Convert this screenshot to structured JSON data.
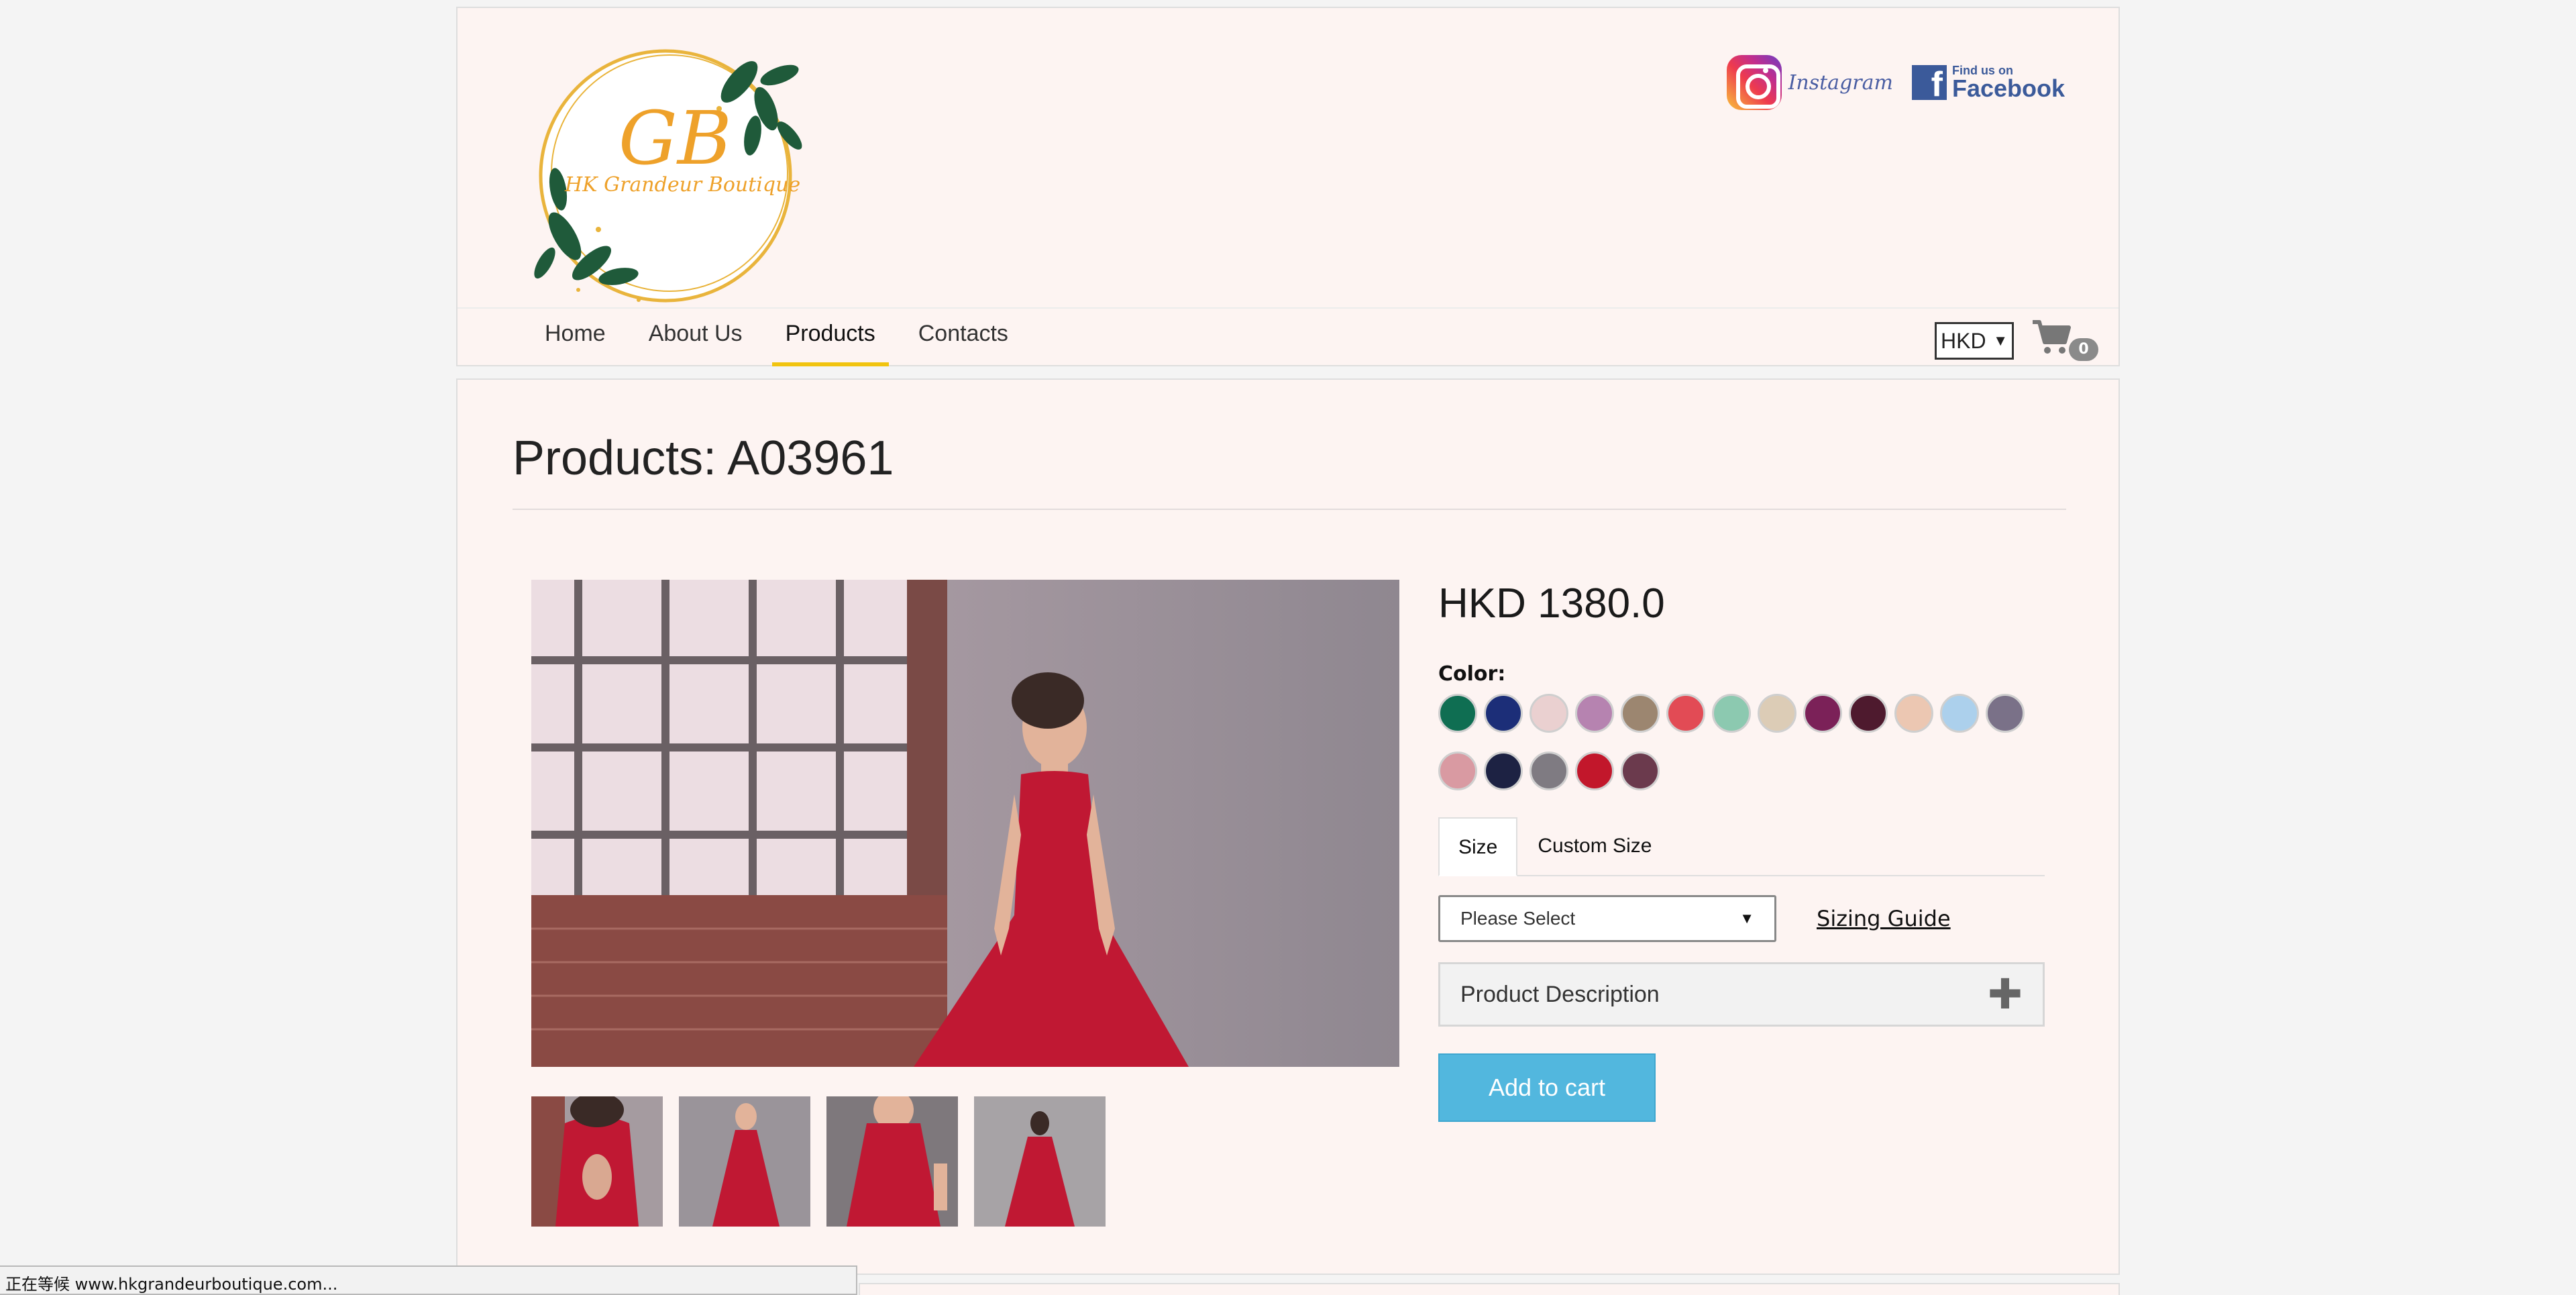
{
  "brand": {
    "logo_initials": "GB",
    "logo_name": "HK Grandeur Boutique"
  },
  "social": {
    "instagram_label": "Instagram",
    "facebook_small": "Find us on",
    "facebook_big": "Facebook"
  },
  "nav": {
    "items": [
      {
        "label": "Home"
      },
      {
        "label": "About Us"
      },
      {
        "label": "Products"
      },
      {
        "label": "Contacts"
      }
    ],
    "currency": "HKD",
    "cart_count": "0"
  },
  "product": {
    "title": "Products: A03961",
    "price": "HKD 1380.0",
    "color_label": "Color:",
    "colors": [
      "#0f6e52",
      "#1c2e78",
      "#ead0d0",
      "#b683b0",
      "#9c8670",
      "#e24b55",
      "#8cc9b0",
      "#dcccb6",
      "#7b2158",
      "#4e1a2e",
      "#ecc7b2",
      "#acd0ec",
      "#7a7188",
      "#d99aa2",
      "#1d2243",
      "#7f7b82",
      "#c2172b",
      "#6b3a4d"
    ],
    "tabs": [
      {
        "label": "Size"
      },
      {
        "label": "Custom Size"
      }
    ],
    "size_placeholder": "Please Select",
    "sizing_guide": "Sizing Guide",
    "description_title": "Product Description",
    "add_to_cart": "Add to cart"
  },
  "status_bar": "正在等候 www.hkgrandeurboutique.com..."
}
